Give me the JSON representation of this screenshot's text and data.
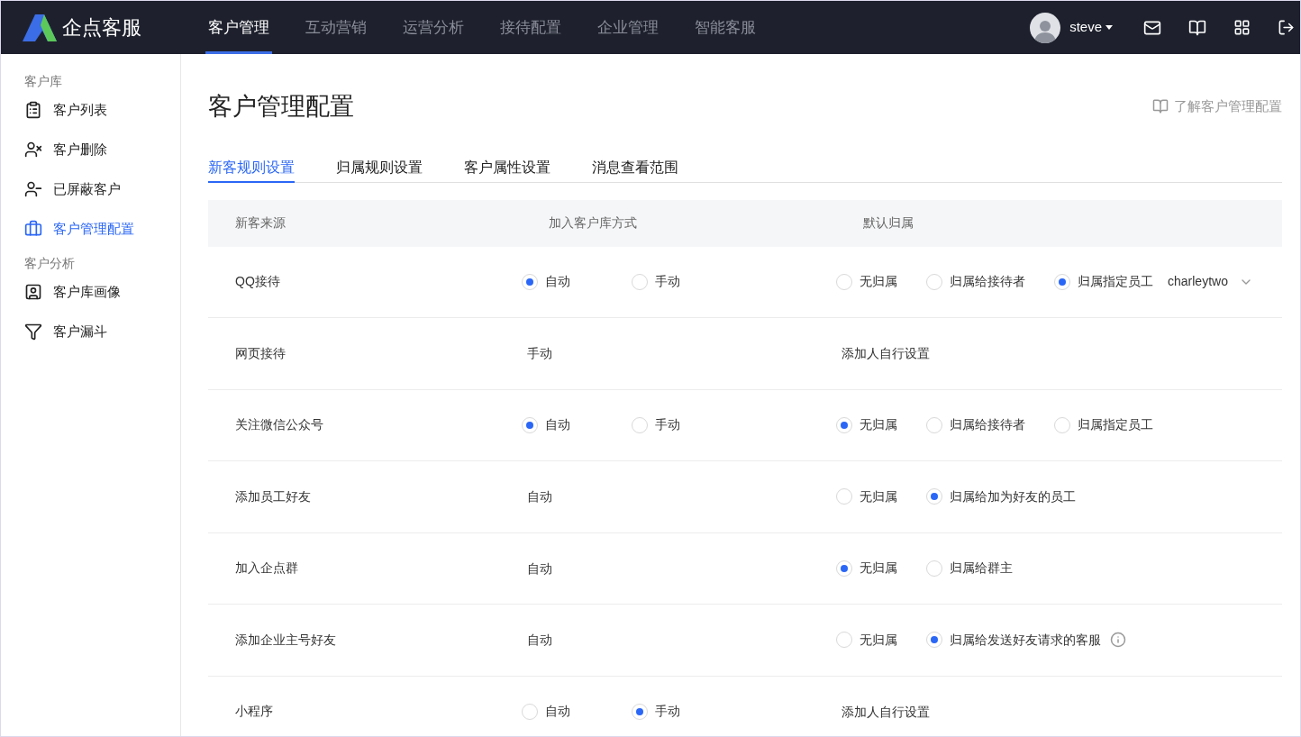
{
  "brand": {
    "name": "企点客服"
  },
  "nav": [
    {
      "label": "客户管理",
      "selected": true
    },
    {
      "label": "互动营销",
      "selected": false
    },
    {
      "label": "运营分析",
      "selected": false
    },
    {
      "label": "接待配置",
      "selected": false
    },
    {
      "label": "企业管理",
      "selected": false
    },
    {
      "label": "智能客服",
      "selected": false
    }
  ],
  "user": {
    "name": "steve"
  },
  "sidebar": [
    {
      "title": "客户库",
      "items": [
        {
          "label": "客户列表",
          "selected": false
        },
        {
          "label": "客户删除",
          "selected": false
        },
        {
          "label": "已屏蔽客户",
          "selected": false
        },
        {
          "label": "客户管理配置",
          "selected": true
        }
      ]
    },
    {
      "title": "客户分析",
      "items": [
        {
          "label": "客户库画像",
          "selected": false
        },
        {
          "label": "客户漏斗",
          "selected": false
        }
      ]
    }
  ],
  "page": {
    "title": "客户管理配置",
    "help_link": "了解客户管理配置"
  },
  "tabs": [
    {
      "label": "新客规则设置",
      "selected": true
    },
    {
      "label": "归属规则设置",
      "selected": false
    },
    {
      "label": "客户属性设置",
      "selected": false
    },
    {
      "label": "消息查看范围",
      "selected": false
    }
  ],
  "table": {
    "columns": [
      "新客来源",
      "加入客户库方式",
      "默认归属"
    ],
    "rows": [
      {
        "source": "QQ接待",
        "join": {
          "kind": "radio",
          "options": [
            {
              "label": "自动",
              "selected": true
            },
            {
              "label": "手动",
              "selected": false
            }
          ]
        },
        "owner": {
          "kind": "radio",
          "options": [
            {
              "label": "无归属",
              "selected": false
            },
            {
              "label": "归属给接待者",
              "selected": false
            },
            {
              "label": "归属指定员工",
              "selected": true
            }
          ],
          "select": "charleytwo"
        }
      },
      {
        "source": "网页接待",
        "join": {
          "kind": "text",
          "text": "手动"
        },
        "owner": {
          "kind": "text",
          "text": "添加人自行设置"
        }
      },
      {
        "source": "关注微信公众号",
        "join": {
          "kind": "radio",
          "options": [
            {
              "label": "自动",
              "selected": true
            },
            {
              "label": "手动",
              "selected": false
            }
          ]
        },
        "owner": {
          "kind": "radio",
          "options": [
            {
              "label": "无归属",
              "selected": true
            },
            {
              "label": "归属给接待者",
              "selected": false
            },
            {
              "label": "归属指定员工",
              "selected": false
            }
          ]
        }
      },
      {
        "source": "添加员工好友",
        "join": {
          "kind": "text",
          "text": "自动"
        },
        "owner": {
          "kind": "radio",
          "options": [
            {
              "label": "无归属",
              "selected": false
            },
            {
              "label": "归属给加为好友的员工",
              "selected": true
            }
          ]
        }
      },
      {
        "source": "加入企点群",
        "join": {
          "kind": "text",
          "text": "自动"
        },
        "owner": {
          "kind": "radio",
          "options": [
            {
              "label": "无归属",
              "selected": true
            },
            {
              "label": "归属给群主",
              "selected": false
            }
          ]
        }
      },
      {
        "source": "添加企业主号好友",
        "join": {
          "kind": "text",
          "text": "自动"
        },
        "owner": {
          "kind": "radio",
          "options": [
            {
              "label": "无归属",
              "selected": false
            },
            {
              "label": "归属给发送好友请求的客服",
              "selected": true
            }
          ],
          "info": true
        }
      },
      {
        "source": "小程序",
        "join": {
          "kind": "radio",
          "options": [
            {
              "label": "自动",
              "selected": false
            },
            {
              "label": "手动",
              "selected": true
            }
          ]
        },
        "owner": {
          "kind": "text",
          "text": "添加人自行设置"
        }
      }
    ]
  }
}
